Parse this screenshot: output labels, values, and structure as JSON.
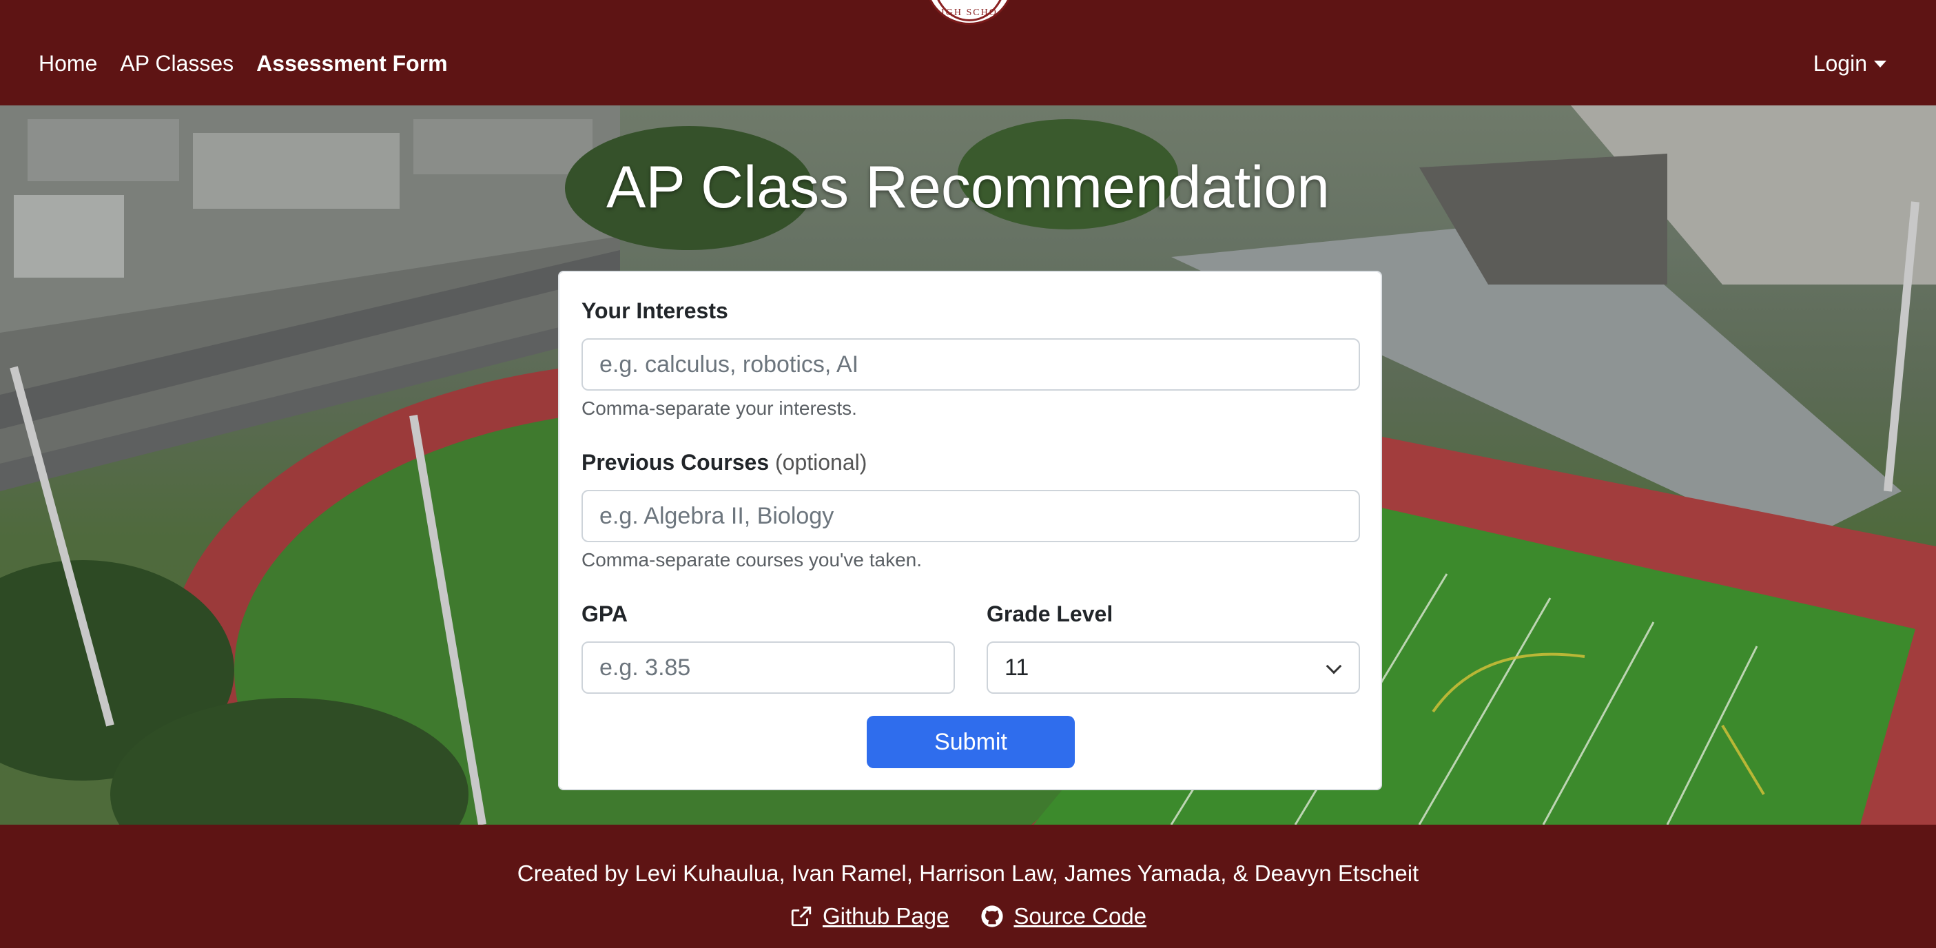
{
  "logo": {
    "text": "IGH SCHO"
  },
  "nav": {
    "links": [
      {
        "label": "Home",
        "active": false
      },
      {
        "label": "AP Classes",
        "active": false
      },
      {
        "label": "Assessment Form",
        "active": true
      }
    ],
    "login_label": "Login"
  },
  "hero": {
    "title": "AP Class Recommendation"
  },
  "form": {
    "interests": {
      "label": "Your Interests",
      "placeholder": "e.g. calculus, robotics, AI",
      "value": "",
      "help": "Comma-separate your interests."
    },
    "courses": {
      "label": "Previous Courses",
      "optional": "(optional)",
      "placeholder": "e.g. Algebra II, Biology",
      "value": "",
      "help": "Comma-separate courses you've taken."
    },
    "gpa": {
      "label": "GPA",
      "placeholder": "e.g. 3.85",
      "value": ""
    },
    "grade": {
      "label": "Grade Level",
      "selected": "11"
    },
    "submit_label": "Submit"
  },
  "footer": {
    "credits": "Created by Levi Kuhaulua, Ivan Ramel, Harrison Law, James Yamada, & Deavyn Etscheit",
    "github_page": "Github Page",
    "source_code": "Source Code",
    "github_page_icon": "external-link-icon",
    "source_code_icon": "github-icon"
  },
  "colors": {
    "brand": "#5e1414",
    "primary_button": "#2f6ded"
  }
}
